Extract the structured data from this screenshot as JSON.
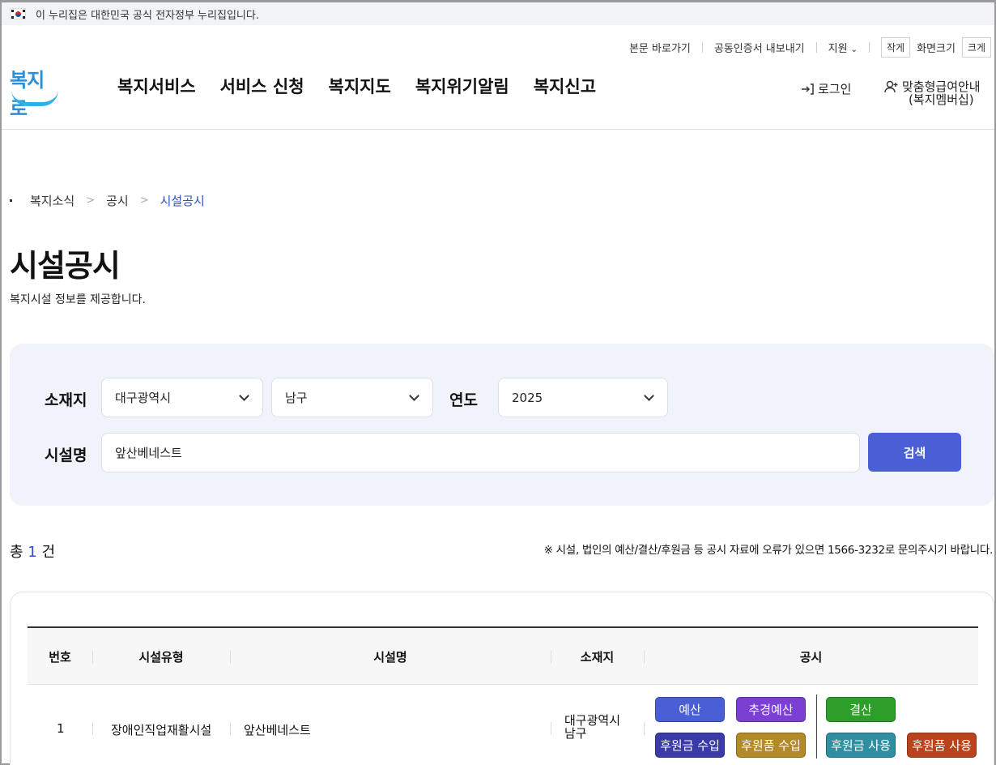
{
  "gov_banner": {
    "text": "이 누리집은 대한민국 공식 전자정부 누리집입니다."
  },
  "utility": {
    "skip_link": "본문 바로가기",
    "cert_export": "공동인증서 내보내기",
    "support": "지원",
    "small": "작게",
    "screen_size": "화면크기",
    "large": "크게"
  },
  "logo": {
    "text": "복지로"
  },
  "gnb": [
    {
      "label": "복지서비스"
    },
    {
      "label": "서비스 신청"
    },
    {
      "label": "복지지도"
    },
    {
      "label": "복지위기알림"
    },
    {
      "label": "복지신고"
    }
  ],
  "header": {
    "login": "로그인",
    "member_line1": "맞춤형급여안내",
    "member_line2": "(복지멤버십)"
  },
  "breadcrumb": {
    "item1": "복지소식",
    "item2": "공시",
    "current": "시설공시"
  },
  "page": {
    "title": "시설공시",
    "desc": "복지시설 정보를 제공합니다."
  },
  "search": {
    "location_label": "소재지",
    "sido": "대구광역시",
    "sigungu": "남구",
    "year_label": "연도",
    "year": "2025",
    "name_label": "시설명",
    "name_value": "앞산베네스트",
    "button": "검색"
  },
  "summary": {
    "prefix": "총",
    "count": "1",
    "suffix": "건",
    "notice": "※ 시설, 법인의 예산/결산/후원금 등 공시 자료에 오류가 있으면 1566-3232로 문의주시기 바랍니다."
  },
  "table": {
    "headers": {
      "no": "번호",
      "type": "시설유형",
      "name": "시설명",
      "location": "소재지",
      "publication": "공시"
    },
    "rows": [
      {
        "no": "1",
        "type": "장애인직업재활시설",
        "name": "앞산베네스트",
        "location_line1": "대구광역시",
        "location_line2": "남구",
        "buttons": {
          "budget": "예산",
          "supp_budget": "추경예산",
          "settlement": "결산",
          "donation_income": "후원금 수입",
          "goods_income": "후원품 수입",
          "donation_use": "후원금 사용",
          "goods_use": "후원품 사용"
        }
      }
    ]
  },
  "colors": {
    "primary": "#4a5fd6",
    "budget": "#4a5fd6",
    "supp_budget": "#7b3fd4",
    "settlement": "#2e9e2a",
    "donation_income": "#3a3aa8",
    "goods_income": "#b38a28",
    "donation_use": "#2f8ea0",
    "goods_use": "#b8431c"
  }
}
